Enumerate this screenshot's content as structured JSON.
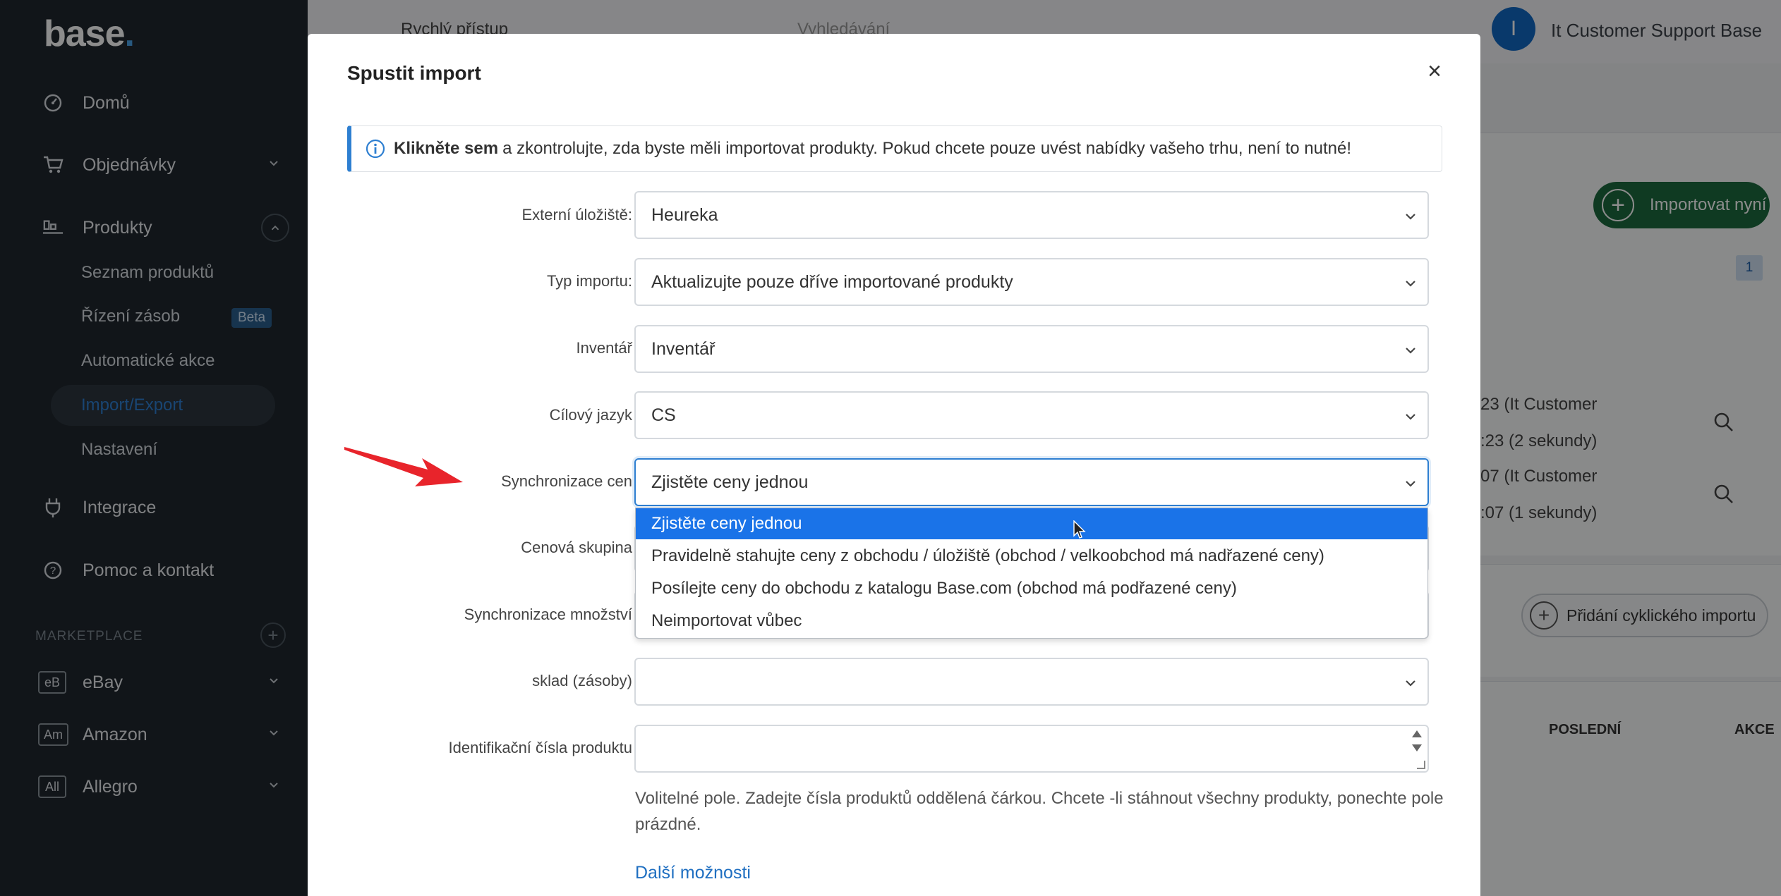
{
  "sidebar": {
    "logo": {
      "text": "base",
      "dot": "."
    },
    "items": [
      {
        "label": "Domů",
        "icon": "dashboard-icon"
      },
      {
        "label": "Objednávky",
        "icon": "cart-icon"
      },
      {
        "label": "Produkty",
        "icon": "products-icon"
      },
      {
        "label": "Integrace",
        "icon": "plug-icon"
      },
      {
        "label": "Pomoc a kontakt",
        "icon": "help-icon"
      }
    ],
    "product_subitems": [
      "Seznam produktů",
      "Řízení zásob",
      "Automatické akce",
      "Import/Export",
      "Nastavení"
    ],
    "beta_badge": "Beta",
    "marketplace_label": "MARKETPLACE",
    "marketplaces": [
      {
        "badge": "eB",
        "label": "eBay"
      },
      {
        "badge": "Am",
        "label": "Amazon"
      },
      {
        "badge": "All",
        "label": "Allegro"
      }
    ]
  },
  "topbar": {
    "quick_access": "Rychlý přístup",
    "search_placeholder": "Vyhledávání",
    "avatar_initial": "I",
    "user_name": "It Customer Support Base"
  },
  "background": {
    "import_now": "Importovat nyní",
    "badge_number": "1",
    "row1_line1": "23 (It Customer",
    "row1_line2": ":23 (2 sekundy)",
    "row2_line1": "07 (It Customer",
    "row2_line2": ":07 (1 sekundy)",
    "cyclic_import": "Přidání cyklického importu",
    "col_last": "POSLEDNÍ",
    "col_action": "AKCE"
  },
  "modal": {
    "title": "Spustit import",
    "close": "×",
    "info_bold": "Klikněte sem",
    "info_text": "a zkontrolujte, zda byste měli importovat produkty. Pokud chcete pouze uvést nabídky vašeho trhu, není to nutné!",
    "fields": {
      "external_storage": {
        "label": "Externí úložiště:",
        "value": "Heureka"
      },
      "import_type": {
        "label": "Typ importu:",
        "value": "Aktualizujte pouze dříve importované produkty"
      },
      "inventory": {
        "label": "Inventář",
        "value": "Inventář"
      },
      "target_language": {
        "label": "Cílový jazyk",
        "value": "CS"
      },
      "price_sync": {
        "label": "Synchronizace cen",
        "value": "Zjistěte ceny jednou"
      },
      "price_group": {
        "label": "Cenová skupina",
        "value": ""
      },
      "quantity_sync": {
        "label": "Synchronizace množství",
        "value": ""
      },
      "warehouse": {
        "label": "sklad (zásoby)",
        "value": ""
      },
      "product_ids": {
        "label": "Identifikační čísla produktu",
        "value": ""
      }
    },
    "price_sync_options": [
      "Zjistěte ceny jednou",
      "Pravidelně stahujte ceny z obchodu / úložiště (obchod / velkoobchod má nadřazené ceny)",
      "Posílejte ceny do obchodu z katalogu Base.com (obchod má podřazené ceny)",
      "Neimportovat vůbec"
    ],
    "help_text": "Volitelné pole. Zadejte čísla produktů oddělená čárkou. Chcete -li stáhnout všechny produkty, ponechte pole prázdné.",
    "more_options": "Další možnosti"
  },
  "colors": {
    "sidebar_bg": "#1f272e",
    "accent": "#2e7fd1",
    "selected_option": "#1a73e8",
    "import_button": "#1d6b3e",
    "arrow": "#e8242b"
  }
}
